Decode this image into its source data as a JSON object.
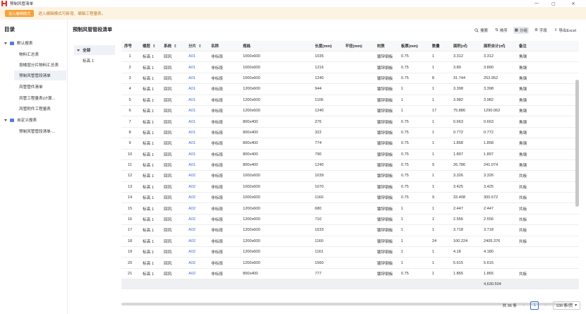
{
  "window": {
    "title": "预制风管清单"
  },
  "banner": {
    "button": "进入编辑模式",
    "text": "进入编辑模式可新增、编辑工程量表。"
  },
  "sidebar": {
    "title": "目录",
    "items": [
      {
        "label": "默认报表",
        "type": "folder"
      },
      {
        "label": "物料汇总表",
        "type": "leaf"
      },
      {
        "label": "按楼层分片物料汇总表",
        "type": "leaf"
      },
      {
        "label": "预制风管管段清单",
        "type": "leaf"
      },
      {
        "label": "风管管件清单",
        "type": "leaf"
      },
      {
        "label": "风管工程量表(计算...",
        "type": "leaf"
      },
      {
        "label": "风管附件工程量表",
        "type": "leaf"
      },
      {
        "label": "自定义报表",
        "type": "folder"
      },
      {
        "label": "预制风管管段清单-...",
        "type": "leaf"
      }
    ]
  },
  "main": {
    "title": "预制风管管段清单",
    "toolbar": {
      "search": "搜索",
      "sort": "排序",
      "group": "分组",
      "field": "字段",
      "export": "导出Excel"
    },
    "groups": [
      "全部",
      "标高 1"
    ]
  },
  "table": {
    "headers": [
      "序号",
      "楼层",
      "系统",
      "分片",
      "名称",
      "规格",
      "长度(mm)",
      "平径(mm)",
      "材质",
      "板厚(mm)",
      "数量",
      "面积(㎡)",
      "面积合计(㎡)",
      "备注"
    ],
    "rows": [
      [
        "1",
        "标高 1",
        "回风",
        "A01",
        "非标段",
        "1000x600",
        "1035",
        "",
        "镀锌钢板",
        "0.75",
        "1",
        "3.312",
        "3.312",
        "角钢"
      ],
      [
        "2",
        "标高 1",
        "回风",
        "A01",
        "非标段",
        "1000x600",
        "1216",
        "",
        "镀锌钢板",
        "0.75",
        "1",
        "3.89",
        "3.890",
        "角钢"
      ],
      [
        "3",
        "标高 1",
        "回风",
        "A01",
        "非标段",
        "1000x600",
        "1240",
        "",
        "镀锌钢板",
        "0.75",
        "8",
        "31.744",
        "253.952",
        "角钢"
      ],
      [
        "4",
        "标高 1",
        "回风",
        "A01",
        "非标段",
        "1200x600",
        "944",
        "",
        "镀锌钢板",
        "1",
        "1",
        "3.398",
        "3.398",
        "角钢"
      ],
      [
        "5",
        "标高 1",
        "回风",
        "A01",
        "非标段",
        "1200x600",
        "1106",
        "",
        "镀锌钢板",
        "1",
        "1",
        "3.982",
        "3.982",
        "角钢"
      ],
      [
        "6",
        "标高 1",
        "回风",
        "A01",
        "非标段",
        "1200x600",
        "1240",
        "",
        "镀锌钢板",
        "1",
        "17",
        "75.886",
        "1290.062",
        "角钢"
      ],
      [
        "7",
        "标高 1",
        "回风",
        "A01",
        "非标段",
        "800x400",
        "276",
        "",
        "镀锌钢板",
        "0.75",
        "1",
        "0.663",
        "0.663",
        "角钢"
      ],
      [
        "8",
        "标高 1",
        "回风",
        "A01",
        "非标段",
        "800x400",
        "322",
        "",
        "镀锌钢板",
        "0.75",
        "1",
        "0.772",
        "0.772",
        "角钢"
      ],
      [
        "9",
        "标高 1",
        "回风",
        "A01",
        "非标段",
        "800x400",
        "774",
        "",
        "镀锌钢板",
        "0.75",
        "1",
        "1.858",
        "1.858",
        "角钢"
      ],
      [
        "10",
        "标高 1",
        "回风",
        "A01",
        "非标段",
        "800x400",
        "790",
        "",
        "镀锌钢板",
        "0.75",
        "1",
        "1.897",
        "1.897",
        "角钢"
      ],
      [
        "11",
        "标高 1",
        "回风",
        "A01",
        "非标段",
        "800x400",
        "1240",
        "",
        "镀锌钢板",
        "0.75",
        "9",
        "26.786",
        "241.074",
        "角钢"
      ],
      [
        "12",
        "标高 1",
        "回风",
        "A02",
        "非标段",
        "1000x600",
        "1039",
        "",
        "镀锌钢板",
        "0.75",
        "1",
        "3.326",
        "3.326",
        "共板"
      ],
      [
        "13",
        "标高 1",
        "回风",
        "A02",
        "非标段",
        "1000x600",
        "1070",
        "",
        "镀锌钢板",
        "0.75",
        "1",
        "3.425",
        "3.425",
        "共板"
      ],
      [
        "14",
        "标高 1",
        "回风",
        "A02",
        "非标段",
        "1000x600",
        "1160",
        "",
        "镀锌钢板",
        "0.75",
        "9",
        "33.408",
        "300.672",
        "共板"
      ],
      [
        "15",
        "标高 1",
        "回风",
        "A02",
        "非标段",
        "1200x600",
        "680",
        "",
        "镀锌钢板",
        "1",
        "1",
        "2.447",
        "2.447",
        "共板"
      ],
      [
        "16",
        "标高 1",
        "回风",
        "A02",
        "非标段",
        "1200x600",
        "710",
        "",
        "镀锌钢板",
        "1",
        "1",
        "2.556",
        "2.556",
        "共板"
      ],
      [
        "17",
        "标高 1",
        "回风",
        "A02",
        "非标段",
        "1200x600",
        "1033",
        "",
        "镀锌钢板",
        "1",
        "1",
        "3.718",
        "3.718",
        "共板"
      ],
      [
        "18",
        "标高 1",
        "回风",
        "A02",
        "非标段",
        "1200x600",
        "1160",
        "",
        "镀锌钢板",
        "1",
        "24",
        "100.224",
        "2405.376",
        "共板"
      ],
      [
        "19",
        "标高 1",
        "回风",
        "A02",
        "非标段",
        "1200x600",
        "1161",
        "",
        "镀锌钢板",
        "1",
        "1",
        "4.18",
        "4.180",
        ""
      ],
      [
        "20",
        "标高 1",
        "回风",
        "A02",
        "非标段",
        "1200x600",
        "1560",
        "",
        "镀锌钢板",
        "1",
        "1",
        "5.615",
        "5.615",
        ""
      ],
      [
        "21",
        "标高 1",
        "回风",
        "A02",
        "非标段",
        "800x400",
        "777",
        "",
        "镀锌钢板",
        "0.75",
        "1",
        "1.865",
        "1.865",
        "共板"
      ]
    ],
    "sum_total": "4,630.504"
  },
  "pager": {
    "total": "共 36 条",
    "page": "1",
    "page_size": "100 条/页",
    "prev": "<",
    "next": ">"
  }
}
